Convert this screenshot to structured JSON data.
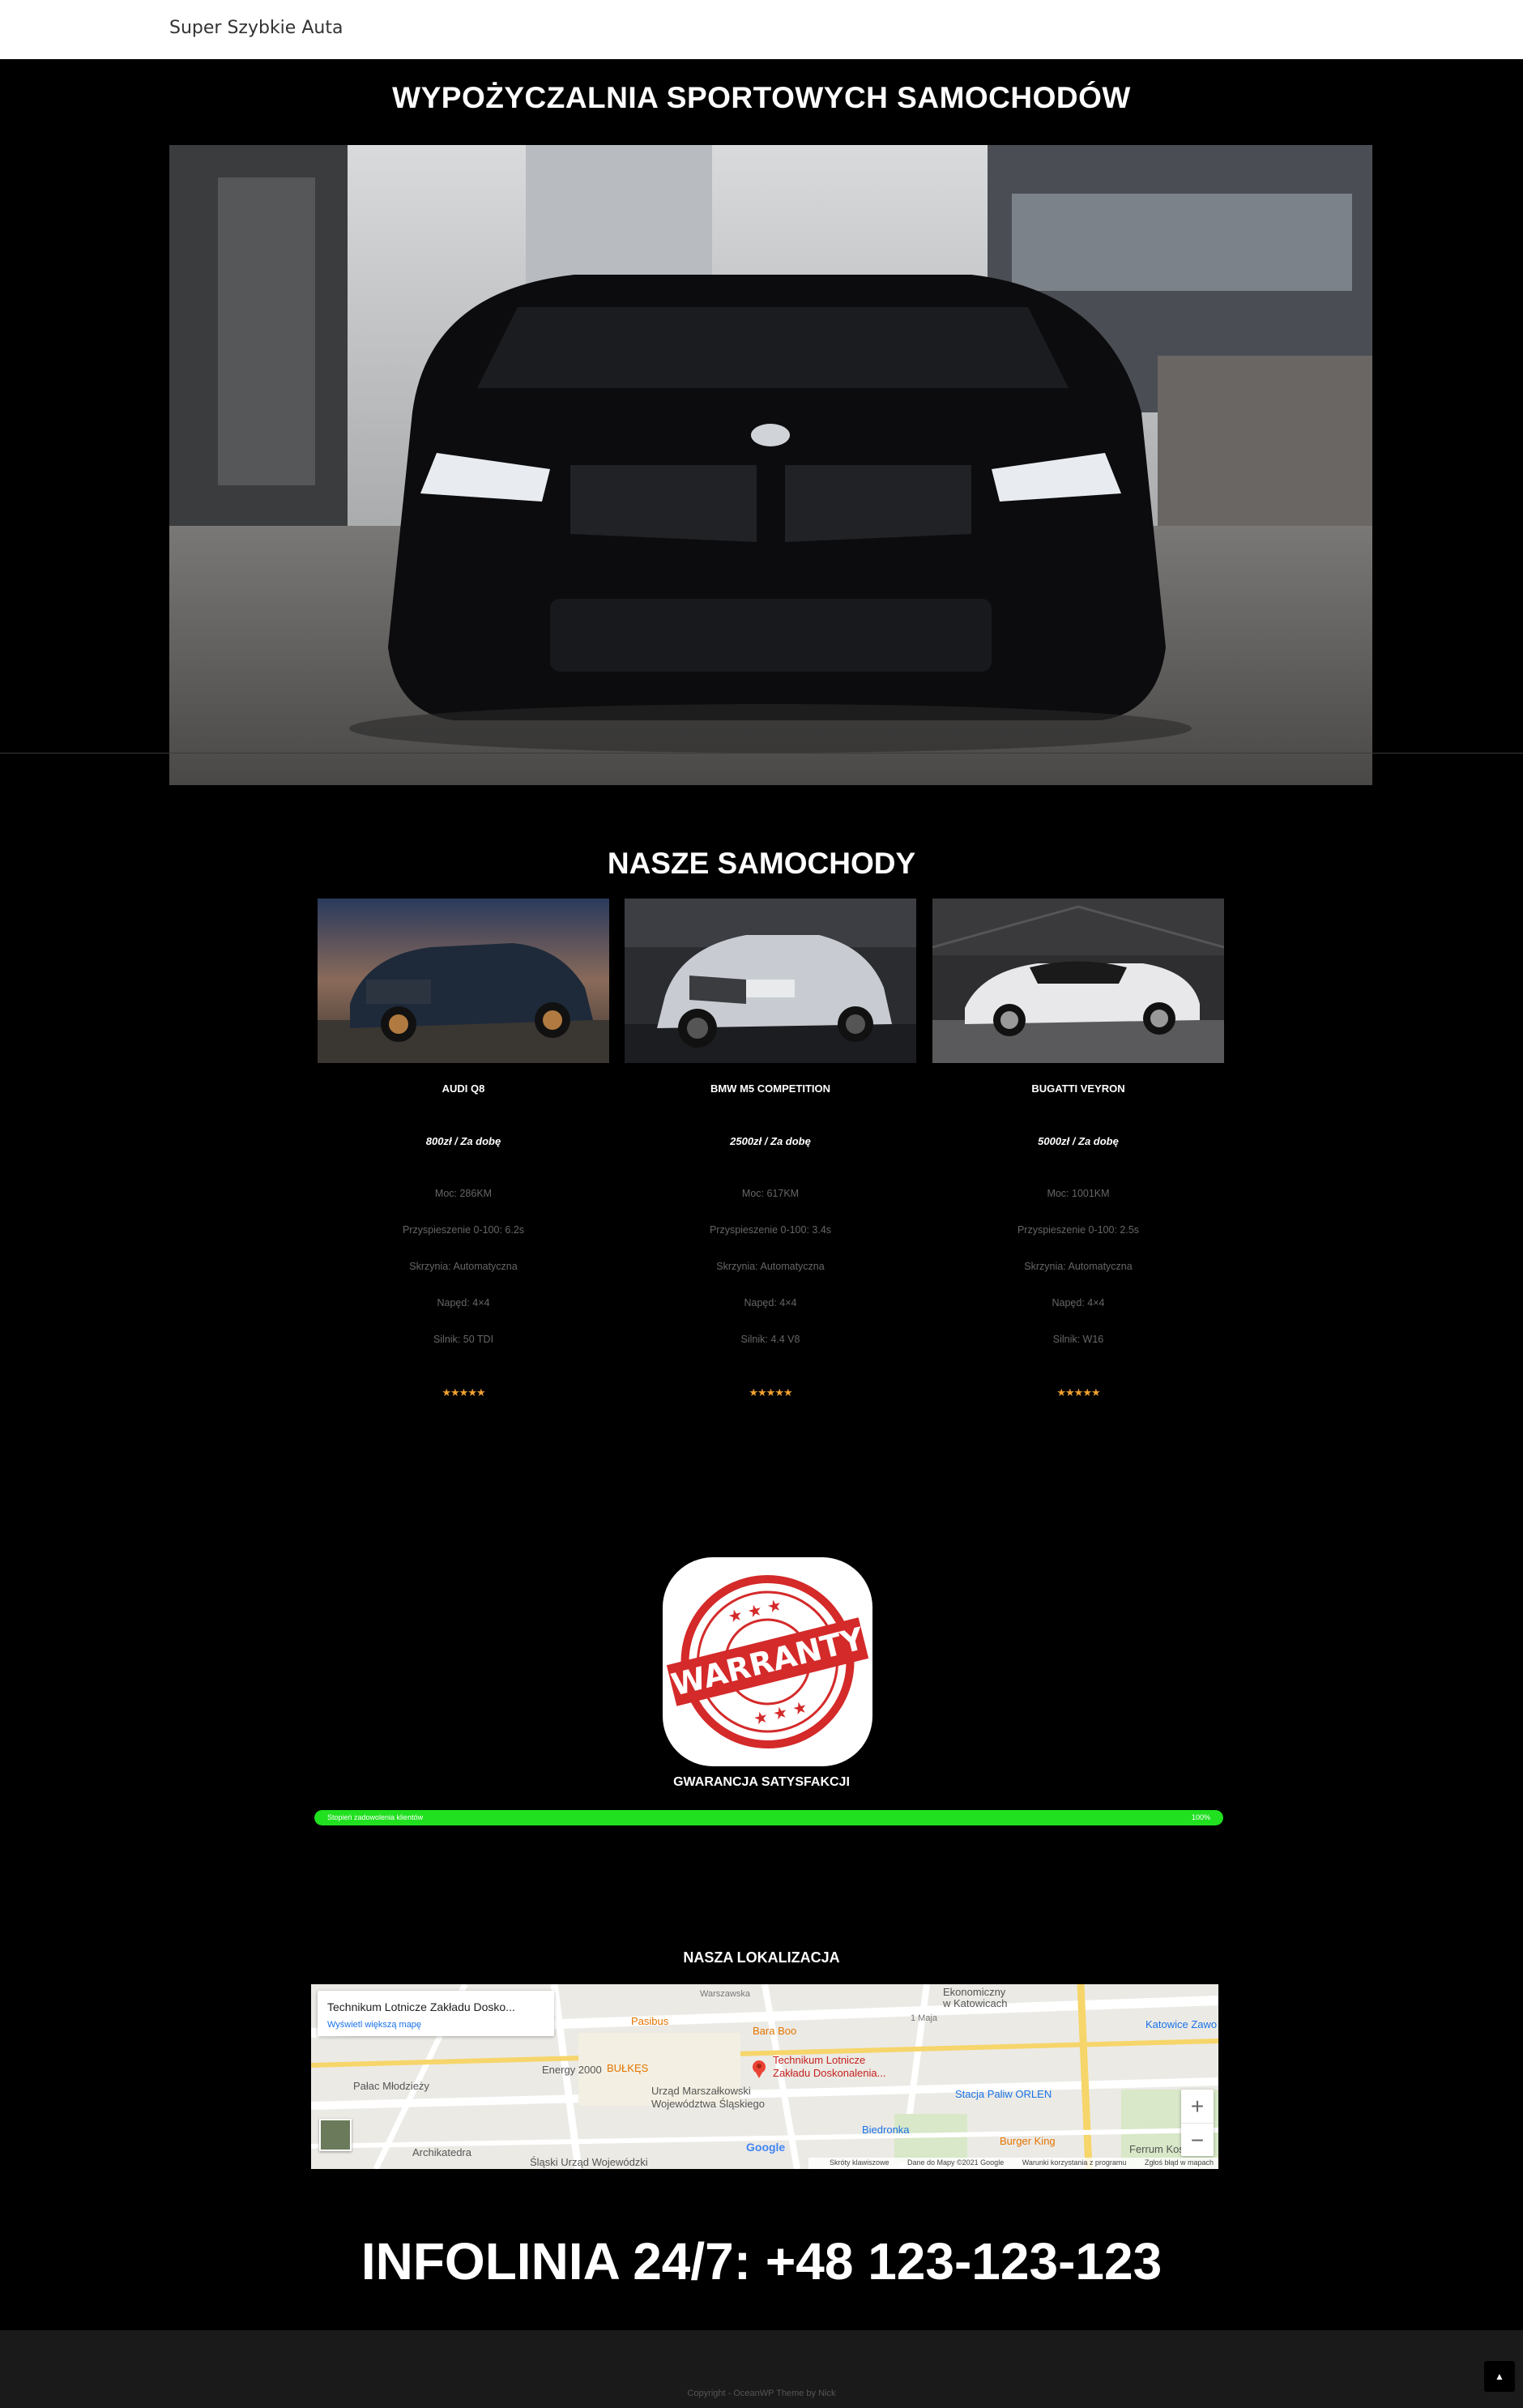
{
  "site": {
    "title": "Super Szybkie Auta"
  },
  "hero": {
    "title": "WYPOŻYCZALNIA SPORTOWYCH SAMOCHODÓW",
    "image_icon": "bmw-m5-hero-photo"
  },
  "cars_section": {
    "title": "NASZE SAMOCHODY"
  },
  "cars": [
    {
      "name": "AUDI Q8",
      "price": "800zł / Za dobę",
      "specs": [
        "Moc: 286KM",
        "Przyspieszenie 0-100: 6.2s",
        "Skrzynia: Automatyczna",
        "Napęd: 4×4",
        "Silnik: 50 TDI"
      ],
      "stars": "★★★★★",
      "rating": 5,
      "image_icon": "audi-q8-photo"
    },
    {
      "name": "BMW M5 COMPETITION",
      "price": "2500zł / Za dobę",
      "specs": [
        "Moc: 617KM",
        "Przyspieszenie 0-100: 3.4s",
        "Skrzynia: Automatyczna",
        "Napęd: 4×4",
        "Silnik: 4.4 V8"
      ],
      "stars": "★★★★★",
      "rating": 5,
      "image_icon": "bmw-m5-photo"
    },
    {
      "name": "BUGATTI VEYRON",
      "price": "5000zł / Za dobę",
      "specs": [
        "Moc: 1001KM",
        "Przyspieszenie 0-100: 2.5s",
        "Skrzynia: Automatyczna",
        "Napęd: 4×4",
        "Silnik: W16"
      ],
      "stars": "★★★★★",
      "rating": 5,
      "image_icon": "bugatti-veyron-photo"
    }
  ],
  "warranty": {
    "stamp_text": "WARRANTY",
    "caption": "GWARANCJA SATYSFAKCJI",
    "progress_label": "Stopień zadowolenia klientów",
    "progress_value": 100,
    "progress_text": "100%",
    "progress_color": "#20e020"
  },
  "location": {
    "title": "NASZA LOKALIZACJA",
    "place_name": "Technikum Lotnicze Zakładu Dosko...",
    "map_link": "Wyświetl większą mapę",
    "pin_label_1": "Technikum Lotnicze",
    "pin_label_2": "Zakładu Doskonalenia...",
    "labels": {
      "pasibus": "Pasibus",
      "bara_boo": "Bara Boo",
      "bulkes": "BUŁKĘS",
      "energy": "Energy 2000",
      "palac": "Pałac Młodzieży",
      "urzad_1": "Urząd Marszałkowski",
      "urzad_2": "Województwa Śląskiego",
      "stacja": "Stacja Paliw ORLEN",
      "biedronka": "Biedronka",
      "burger": "Burger King",
      "ferrum": "Ferrum Kosmos",
      "archikatedra": "Archikatedra",
      "slaski_urzad": "Śląski Urząd Wojewódzki",
      "ekonomiczny_1": "Ekonomiczny",
      "ekonomiczny_2": "w Katowicach",
      "katowice": "Katowice Zawo",
      "warszawska": "Warszawska",
      "maja": "1 Maja"
    },
    "google": "Google",
    "zoom_in": "+",
    "zoom_out": "−",
    "footer_shortcuts": "Skróty klawiszowe",
    "footer_data": "Dane do Mapy ©2021 Google",
    "footer_terms": "Warunki korzystania z programu",
    "footer_report": "Zgłoś błąd w mapach"
  },
  "infoline": {
    "text": "INFOLINIA 24/7: +48 123-123-123"
  },
  "footer": {
    "copyright": "Copyright - OceanWP Theme by Nick",
    "scroll_top_icon": "chevron-up-icon"
  }
}
